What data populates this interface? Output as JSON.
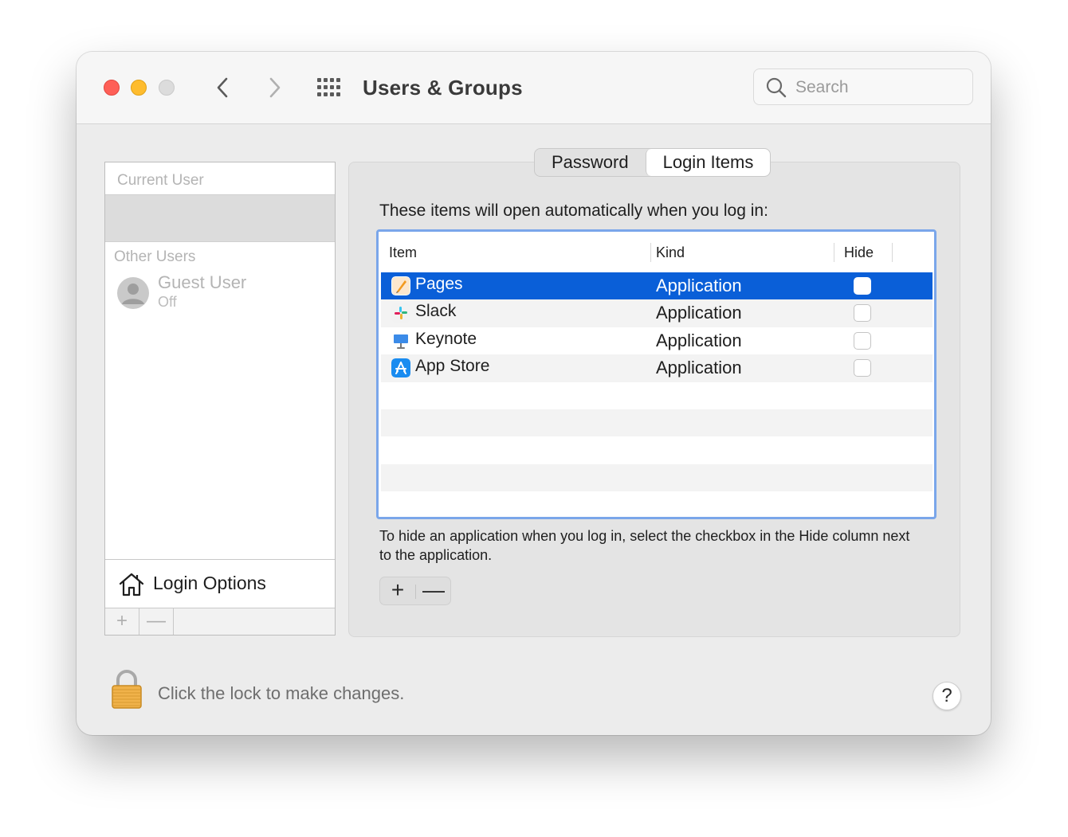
{
  "window": {
    "title": "Users & Groups"
  },
  "search": {
    "placeholder": "Search"
  },
  "users_pane": {
    "current_user_header": "Current User",
    "other_users_header": "Other Users",
    "guest": {
      "name": "Guest User",
      "status": "Off"
    },
    "login_options_label": "Login Options",
    "add_label": "+",
    "remove_label": "—"
  },
  "tabs": [
    {
      "label": "Password",
      "active": false
    },
    {
      "label": "Login Items",
      "active": true
    }
  ],
  "login_items": {
    "intro": "These items will open automatically when you log in:",
    "columns": {
      "item": "Item",
      "kind": "Kind",
      "hide": "Hide"
    },
    "rows": [
      {
        "name": "Pages",
        "kind": "Application",
        "icon": "pages-app-icon",
        "selected": true,
        "hide": false
      },
      {
        "name": "Slack",
        "kind": "Application",
        "icon": "slack-app-icon",
        "selected": false,
        "hide": false
      },
      {
        "name": "Keynote",
        "kind": "Application",
        "icon": "keynote-app-icon",
        "selected": false,
        "hide": false
      },
      {
        "name": "App Store",
        "kind": "Application",
        "icon": "app-store-app-icon",
        "selected": false,
        "hide": false
      }
    ],
    "hint": "To hide an application when you log in, select the checkbox in the Hide column next to the application.",
    "add_label": "+",
    "remove_label": "—"
  },
  "footer": {
    "lock_message": "Click the lock to make changes.",
    "help_label": "?"
  },
  "colors": {
    "selection": "#0a5fd8",
    "focus_ring": "#7aa6ea",
    "window_bg": "#ececec"
  }
}
